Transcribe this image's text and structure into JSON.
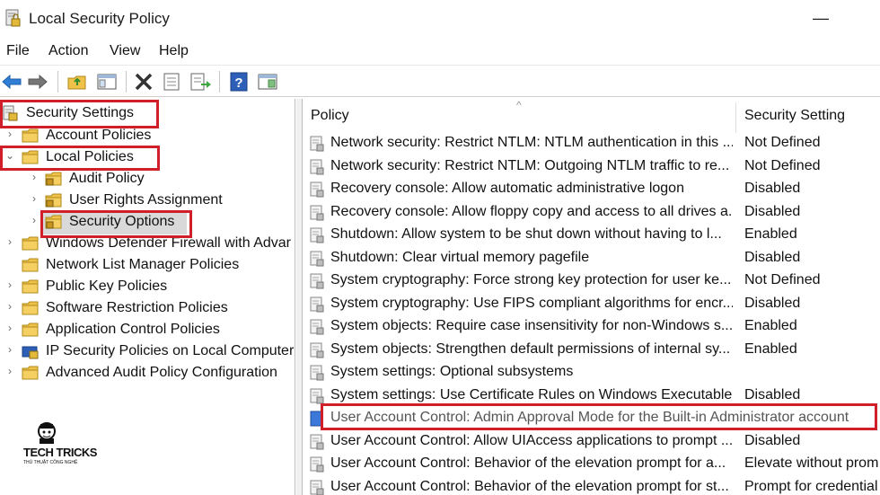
{
  "window": {
    "title": "Local Security Policy",
    "minimize_glyph": "—"
  },
  "menu": [
    "File",
    "Action",
    "View",
    "Help"
  ],
  "toolbar_icons": [
    "back-arrow-icon",
    "forward-arrow-icon",
    "up-folder-icon",
    "show-hide-tree-icon",
    "delete-icon",
    "properties-icon",
    "export-list-icon",
    "help-icon",
    "console-icon"
  ],
  "tree": {
    "items": [
      {
        "label": "Security Settings",
        "arrow": "",
        "level": 0,
        "icon": "security-settings-icon"
      },
      {
        "label": "Account Policies",
        "arrow": "›",
        "level": 1,
        "icon": "folder-icon"
      },
      {
        "label": "Local Policies",
        "arrow": "⌄",
        "level": 1,
        "icon": "folder-icon"
      },
      {
        "label": "Audit Policy",
        "arrow": "›",
        "level": 2,
        "icon": "folder-icon"
      },
      {
        "label": "User Rights Assignment",
        "arrow": "›",
        "level": 2,
        "icon": "folder-icon"
      },
      {
        "label": "Security Options",
        "arrow": "›",
        "level": 2,
        "icon": "folder-icon"
      },
      {
        "label": "Windows Defender Firewall with Advar",
        "arrow": "›",
        "level": 1,
        "icon": "folder-icon"
      },
      {
        "label": "Network List Manager Policies",
        "arrow": "",
        "level": 1,
        "icon": "folder-icon"
      },
      {
        "label": "Public Key Policies",
        "arrow": "›",
        "level": 1,
        "icon": "folder-icon"
      },
      {
        "label": "Software Restriction Policies",
        "arrow": "›",
        "level": 1,
        "icon": "folder-icon"
      },
      {
        "label": "Application Control Policies",
        "arrow": "›",
        "level": 1,
        "icon": "folder-icon"
      },
      {
        "label": "IP Security Policies on Local Computer",
        "arrow": "›",
        "level": 1,
        "icon": "ip-security-icon"
      },
      {
        "label": "Advanced Audit Policy Configuration",
        "arrow": "›",
        "level": 1,
        "icon": "folder-icon"
      }
    ]
  },
  "list": {
    "columns": {
      "policy": "Policy",
      "setting": "Security Setting"
    },
    "rows": [
      {
        "policy": "Network security: Restrict NTLM: NTLM authentication in this ...",
        "setting": "Not Defined"
      },
      {
        "policy": "Network security: Restrict NTLM: Outgoing NTLM traffic to re...",
        "setting": "Not Defined"
      },
      {
        "policy": "Recovery console: Allow automatic administrative logon",
        "setting": "Disabled"
      },
      {
        "policy": "Recovery console: Allow floppy copy and access to all drives a...",
        "setting": "Disabled"
      },
      {
        "policy": "Shutdown: Allow system to be shut down without having to l...",
        "setting": "Enabled"
      },
      {
        "policy": "Shutdown: Clear virtual memory pagefile",
        "setting": "Disabled"
      },
      {
        "policy": "System cryptography: Force strong key protection for user ke...",
        "setting": "Not Defined"
      },
      {
        "policy": "System cryptography: Use FIPS compliant algorithms for encr...",
        "setting": "Disabled"
      },
      {
        "policy": "System objects: Require case insensitivity for non-Windows s...",
        "setting": "Enabled"
      },
      {
        "policy": "System objects: Strengthen default permissions of internal sy...",
        "setting": "Enabled"
      },
      {
        "policy": "System settings: Optional subsystems",
        "setting": ""
      },
      {
        "policy": "System settings: Use Certificate Rules on Windows Executable...",
        "setting": "Disabled"
      },
      {
        "policy": "User Account Control: Admin Approval Mode for the Built-in Administrator account",
        "setting": ""
      },
      {
        "policy": "User Account Control: Allow UIAccess applications to prompt ...",
        "setting": "Disabled"
      },
      {
        "policy": "User Account Control: Behavior of the elevation prompt for a...",
        "setting": "Elevate without prom"
      },
      {
        "policy": "User Account Control: Behavior of the elevation prompt for st...",
        "setting": "Prompt for credential"
      }
    ]
  },
  "watermark": {
    "name": "TECH TRICKS",
    "tagline": "THỦ THUẬT CÔNG NGHỆ"
  },
  "colors": {
    "highlight_red": "#d11f2a",
    "folder_yellow": "#f0c24a",
    "selected_gray": "#d9d9d9"
  }
}
